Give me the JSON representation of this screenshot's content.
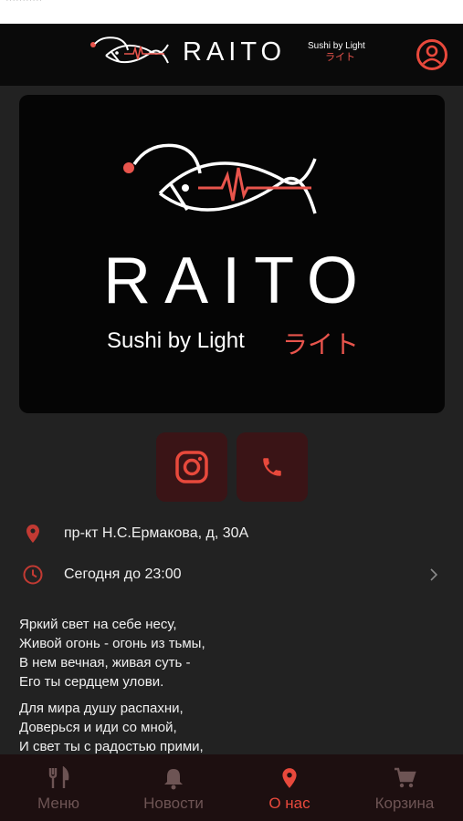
{
  "status": {
    "text": "···········"
  },
  "header": {
    "brand": "RAITO",
    "tagline": "Sushi by Light",
    "tagline_jp": "ライト"
  },
  "hero": {
    "title": "RAITO",
    "tagline": "Sushi by Light",
    "tagline_jp": "ライト"
  },
  "contact": {
    "address": "пр-кт Н.С.Ермакова, д, 30А",
    "hours": "Сегодня до 23:00"
  },
  "poem": {
    "stanza1": [
      "Яркий свет на себе несу,",
      "Живой огонь - огонь из тьмы,",
      "В нем вечная, живая суть -",
      "Его ты сердцем улови."
    ],
    "stanza2": [
      "Для мира душу распахни,",
      "Доверься и иди со мной,",
      "И свет ты с радостью прими,"
    ]
  },
  "tabs": [
    {
      "label": "Меню",
      "icon": "fork-knife-icon",
      "active": false
    },
    {
      "label": "Новости",
      "icon": "bell-icon",
      "active": false
    },
    {
      "label": "О нас",
      "icon": "map-pin-icon",
      "active": true
    },
    {
      "label": "Корзина",
      "icon": "cart-icon",
      "active": false
    }
  ],
  "colors": {
    "accent": "#e8493c",
    "background": "#222222",
    "header": "#0a0a0a",
    "tabbar": "#1d0f10"
  }
}
